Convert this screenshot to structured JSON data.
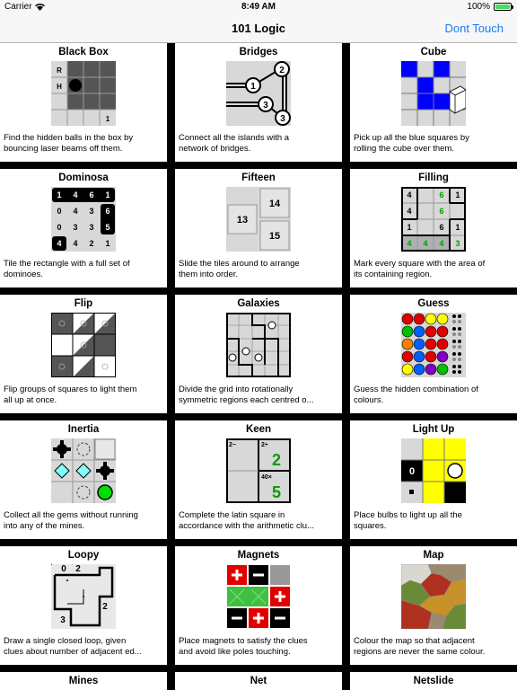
{
  "status_bar": {
    "carrier": "Carrier",
    "time": "8:49 AM",
    "battery": "100%",
    "battery_level": 1.0
  },
  "nav": {
    "title": "101 Logic",
    "right_button": "Dont Touch"
  },
  "puzzles": [
    {
      "title": "Black Box",
      "desc1": "Find the hidden balls in the box by",
      "desc2": "bouncing laser beams off them."
    },
    {
      "title": "Bridges",
      "desc1": "Connect all the islands with a",
      "desc2": "network of bridges."
    },
    {
      "title": "Cube",
      "desc1": "Pick up all the blue squares by",
      "desc2": "rolling the cube over them."
    },
    {
      "title": "Dominosa",
      "desc1": "Tile the rectangle with a full set of",
      "desc2": "dominoes."
    },
    {
      "title": "Fifteen",
      "desc1": "Slide the tiles around to arrange",
      "desc2": "them into order."
    },
    {
      "title": "Filling",
      "desc1": "Mark every square with the area of",
      "desc2": "its containing region."
    },
    {
      "title": "Flip",
      "desc1": "Flip groups of squares to light them",
      "desc2": "all up at once."
    },
    {
      "title": "Galaxies",
      "desc1": "Divide the grid into rotationally",
      "desc2": "symmetric regions each centred o..."
    },
    {
      "title": "Guess",
      "desc1": "Guess the hidden combination of",
      "desc2": "colours."
    },
    {
      "title": "Inertia",
      "desc1": "Collect all the gems without running",
      "desc2": "into any of the mines."
    },
    {
      "title": "Keen",
      "desc1": "Complete the latin square in",
      "desc2": "accordance with the arithmetic clu..."
    },
    {
      "title": "Light Up",
      "desc1": "Place bulbs to light up all the",
      "desc2": "squares."
    },
    {
      "title": "Loopy",
      "desc1": "Draw a single closed loop, given",
      "desc2": "clues about number of adjacent ed..."
    },
    {
      "title": "Magnets",
      "desc1": "Place magnets to satisfy the clues",
      "desc2": "and avoid like poles touching."
    },
    {
      "title": "Map",
      "desc1": "Colour the map so that adjacent",
      "desc2": "regions are never the same colour."
    },
    {
      "title": "Mines",
      "desc1": "",
      "desc2": ""
    },
    {
      "title": "Net",
      "desc1": "",
      "desc2": ""
    },
    {
      "title": "Netslide",
      "desc1": "",
      "desc2": ""
    }
  ],
  "thumbs": {
    "blackbox": {
      "row_labels": [
        "R",
        "H"
      ],
      "number": "1"
    },
    "bridges": {
      "islands": [
        "1",
        "2",
        "3",
        "3"
      ]
    },
    "dominosa": {
      "rows": [
        [
          "1",
          "4",
          "6",
          "1"
        ],
        [
          "0",
          "4",
          "3",
          "6"
        ],
        [
          "0",
          "3",
          "3",
          "5"
        ],
        [
          "4",
          "4",
          "2",
          "1"
        ]
      ]
    },
    "fifteen": {
      "tiles": [
        "14",
        "13",
        "15"
      ]
    },
    "filling": {
      "rows": [
        [
          "4",
          "",
          "6",
          "1"
        ],
        [
          "4",
          "",
          "6",
          ""
        ],
        [
          "1",
          "",
          "6",
          "1"
        ],
        [
          "4",
          "4",
          "4",
          "3"
        ]
      ]
    },
    "keen": {
      "clues": [
        "2−",
        "2÷",
        "40×"
      ],
      "values": [
        "2",
        "5"
      ]
    },
    "lightup": {
      "clue": "0"
    },
    "loopy": {
      "clues": [
        "0",
        "2",
        "2",
        "3"
      ]
    }
  },
  "colors": {
    "nav_button": "#1a7cf4",
    "cube_blue": "#0000ff",
    "green_digit": "#00a000",
    "lightup_yellow": "#ffff00"
  }
}
